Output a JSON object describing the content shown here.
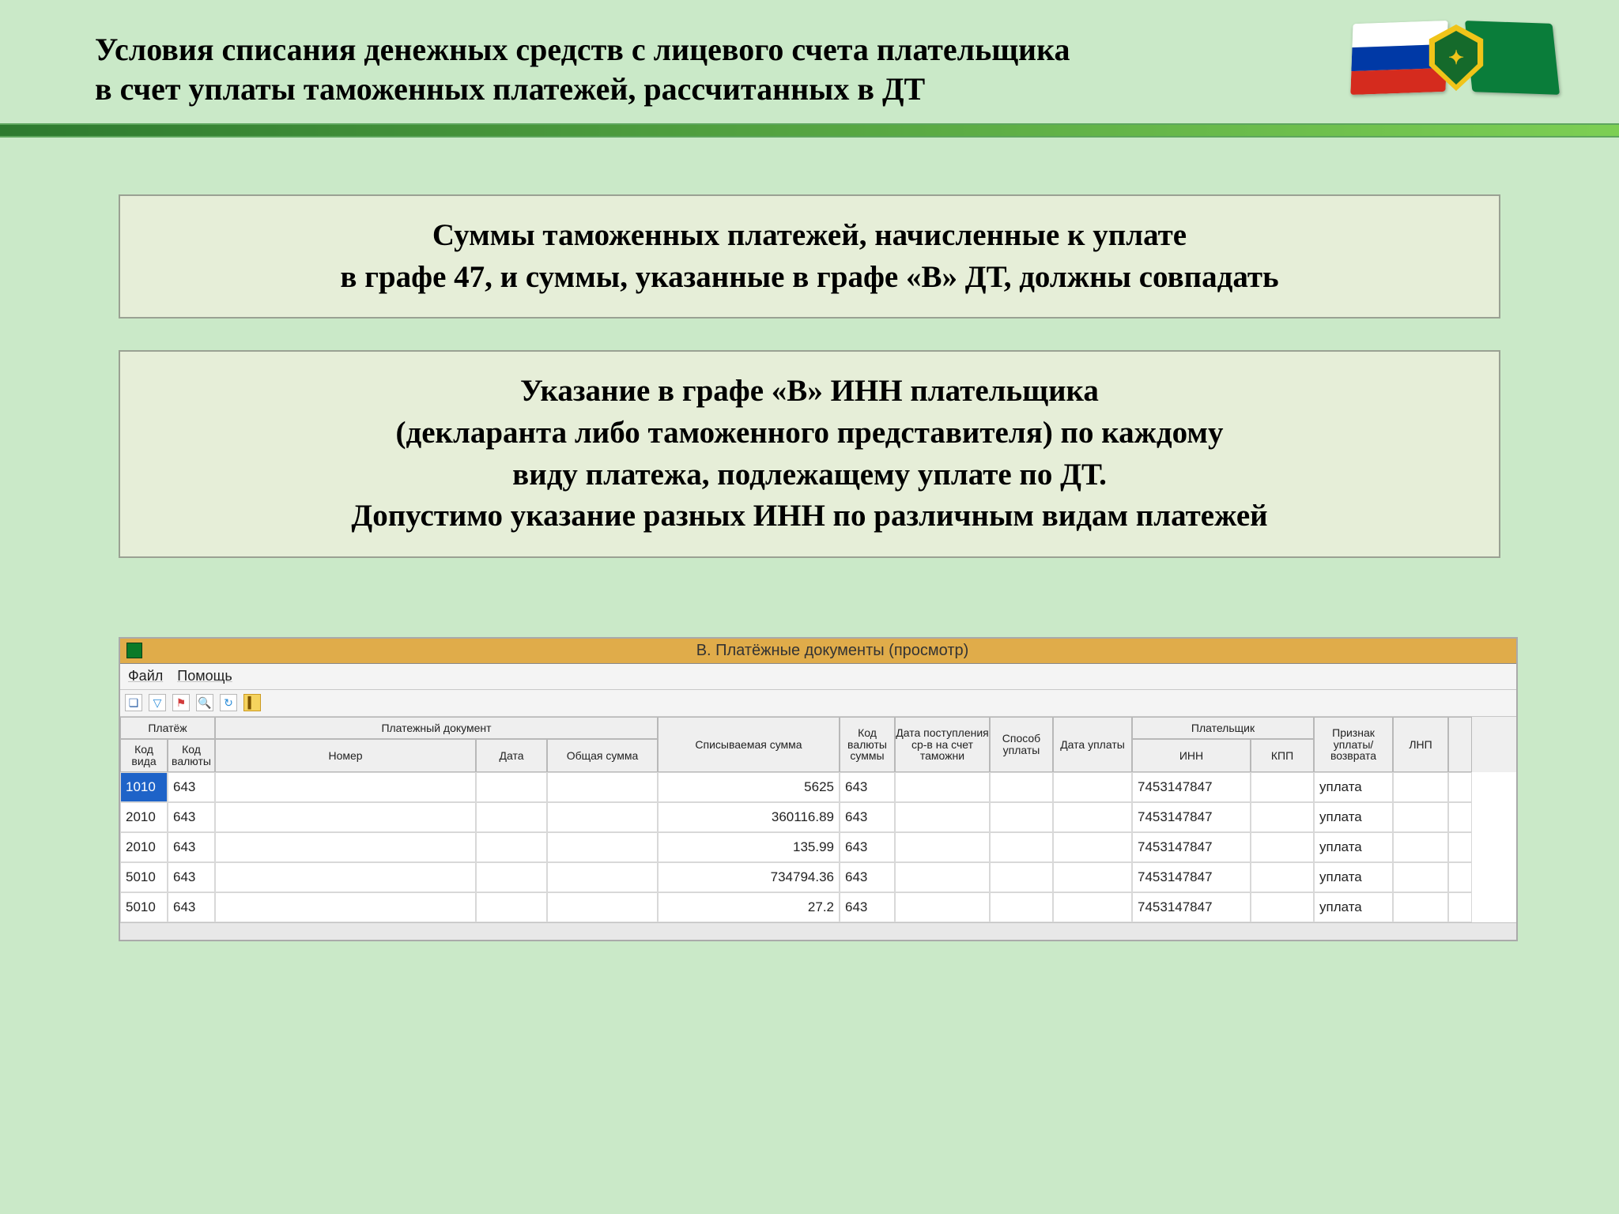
{
  "header": {
    "title_l1": "Условия списания денежных средств с лицевого счета плательщика",
    "title_l2": "в счет уплаты таможенных платежей, рассчитанных в ДТ"
  },
  "box1": {
    "l1": "Суммы таможенных платежей, начисленные к уплате",
    "l2": "в графе 47, и суммы, указанные в графе «В» ДТ, должны совпадать"
  },
  "box2": {
    "l1": "Указание в графе «В» ИНН плательщика",
    "l2": "(декларанта либо таможенного представителя) по каждому",
    "l3": "виду платежа, подлежащему уплате по ДТ.",
    "l4": "Допустимо указание разных ИНН по различным видам платежей"
  },
  "window": {
    "title": "В. Платёжные документы (просмотр)",
    "menu": {
      "file": "Файл",
      "help": "Помощь"
    },
    "headers": {
      "group_platezh": "Платёж",
      "group_doc": "Платежный документ",
      "group_payer": "Плательщик",
      "kod_vida": "Код вида",
      "kod_valyuty": "Код валюты",
      "nomer": "Номер",
      "data": "Дата",
      "obshaya_summa": "Общая сумма",
      "spisyvaemaya": "Списываемая сумма",
      "kod_valyuty_summy": "Код валюты суммы",
      "data_post": "Дата поступления ср-в на счет таможни",
      "sposob": "Способ уплаты",
      "data_uplaty": "Дата уплаты",
      "inn": "ИНН",
      "kpp": "КПП",
      "priznak": "Признак уплаты/ возврата",
      "lnp": "ЛНП"
    },
    "rows": [
      {
        "kod_vida": "1010",
        "kod_valyuty": "643",
        "spis": "5625",
        "kvs": "643",
        "inn": "7453147847",
        "priznak": "уплата"
      },
      {
        "kod_vida": "2010",
        "kod_valyuty": "643",
        "spis": "360116.89",
        "kvs": "643",
        "inn": "7453147847",
        "priznak": "уплата"
      },
      {
        "kod_vida": "2010",
        "kod_valyuty": "643",
        "spis": "135.99",
        "kvs": "643",
        "inn": "7453147847",
        "priznak": "уплата"
      },
      {
        "kod_vida": "5010",
        "kod_valyuty": "643",
        "spis": "734794.36",
        "kvs": "643",
        "inn": "7453147847",
        "priznak": "уплата"
      },
      {
        "kod_vida": "5010",
        "kod_valyuty": "643",
        "spis": "27.2",
        "kvs": "643",
        "inn": "7453147847",
        "priznak": "уплата"
      }
    ]
  }
}
